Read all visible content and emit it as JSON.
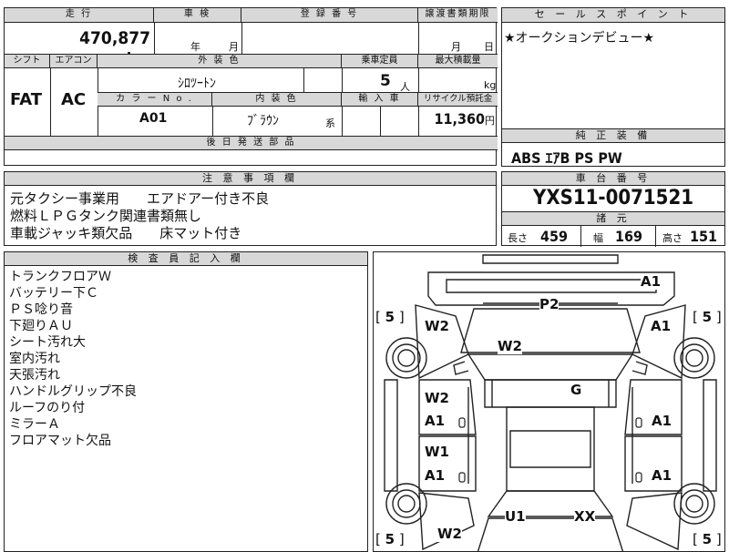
{
  "top": {
    "mileage_header": "走 行",
    "mileage_value": "470,877",
    "mileage_unit": "km",
    "shaken_header": "車 検",
    "shaken_year": "年",
    "shaken_month": "月",
    "reg_header": "登 録 番 号",
    "transfer_header": "譲渡書類期限",
    "transfer_month": "月",
    "transfer_day": "日",
    "shift_header": "シフト",
    "shift_value": "FAT",
    "ac_header": "エアコン",
    "ac_value": "AC",
    "ext_color_header": "外 装 色",
    "ext_color_value": "ｼﾛﾂｰﾄﾝ",
    "capacity_header": "乗車定員",
    "capacity_value": "5",
    "capacity_unit": "人",
    "maxload_header": "最大積載量",
    "maxload_unit": "kg",
    "colorno_header": "カ ラ ー N o .",
    "colorno_value": "A01",
    "int_color_header": "内 装 色",
    "int_color_value": "ﾌﾞﾗｳﾝ",
    "int_color_suffix": "系",
    "import_header": "輸 入 車",
    "recycle_header": "リサイクル預託金",
    "recycle_value": "11,360",
    "recycle_unit": "円",
    "later_parts_header": "後 日 発 送 部 品"
  },
  "sales": {
    "header": "セ ー ル ス ポ イ ン ト",
    "text": "★オークションデビュー★"
  },
  "equipment": {
    "header": "純 正 装 備",
    "text": "ABS ｴｱB PS PW"
  },
  "notes": {
    "header": "注 意 事 項 欄",
    "lines": [
      "元タクシー事業用　　エアドアー付き不良",
      "燃料ＬＰＧタンク関連書類無し",
      "車載ジャッキ類欠品　　床マット付き"
    ]
  },
  "chassis": {
    "header": "車 台 番 号",
    "value": "YXS11-0071521"
  },
  "specs": {
    "header": "諸 元",
    "length_label": "長さ",
    "length_value": "459",
    "width_label": "幅",
    "width_value": "169",
    "height_label": "高さ",
    "height_value": "151"
  },
  "inspector": {
    "header": "検 査 員 記 入 欄",
    "lines": [
      "トランクフロアＷ",
      "バッテリー下Ｃ",
      "ＰＳ唸り音",
      "下廻りＡＵ",
      "シート汚れ大",
      "室内汚れ",
      "天張汚れ",
      "ハンドルグリップ不良",
      "ルーフのり付",
      "ミラーＡ",
      "フロアマット欠品"
    ]
  },
  "diagram": {
    "labels": {
      "a1_top": "A1",
      "p2": "P2",
      "w2_left_top": "W2",
      "w2_center": "W2",
      "a1_right_top": "A1",
      "g": "G",
      "w2_left_door": "W2",
      "a1_left_door": "A1",
      "a1_right_door": "A1",
      "w1_left_door": "W1",
      "a1_left_rear_door": "A1",
      "a1_right_rear_door": "A1",
      "u1": "U1",
      "xx": "XX",
      "w2_bottom": "W2"
    },
    "tires": {
      "tl": "5",
      "tr": "5",
      "bl": "5",
      "br": "5"
    }
  }
}
